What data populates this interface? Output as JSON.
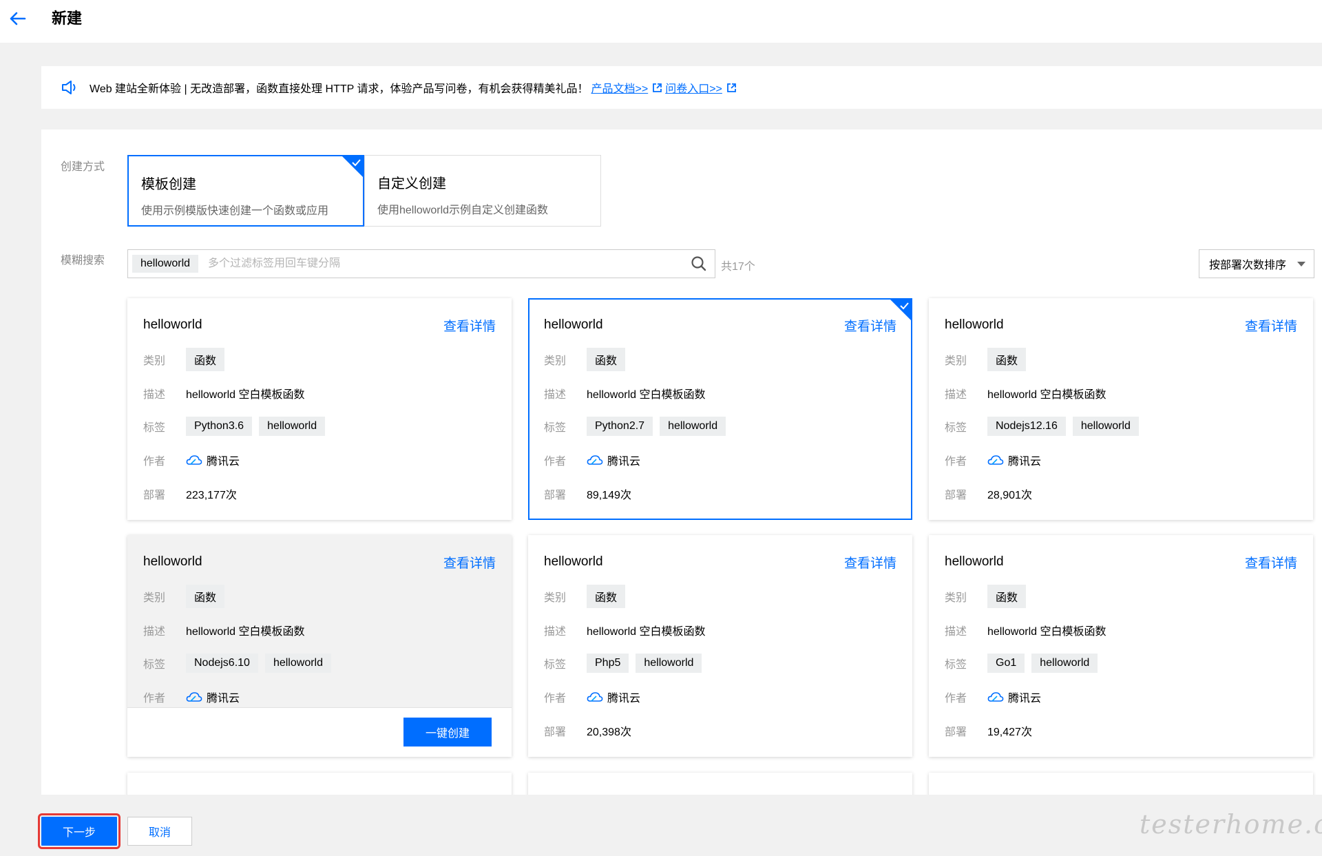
{
  "header": {
    "title": "新建"
  },
  "notice": {
    "text": "Web 建站全新体验 | 无改造部署，函数直接处理 HTTP 请求，体验产品写问卷，有机会获得精美礼品！",
    "link1": "产品文档>>",
    "link2": "问卷入口>>"
  },
  "create_mode": {
    "label": "创建方式",
    "options": [
      {
        "title": "模板创建",
        "desc": "使用示例模版快速创建一个函数或应用"
      },
      {
        "title": "自定义创建",
        "desc": "使用helloworld示例自定义创建函数"
      }
    ]
  },
  "search": {
    "label": "模糊搜索",
    "tag": "helloworld",
    "placeholder": "多个过滤标签用回车键分隔",
    "count": "共17个",
    "sort": "按部署次数排序"
  },
  "card_labels": {
    "detail": "查看详情",
    "category": "类别",
    "desc": "描述",
    "tags": "标签",
    "author": "作者",
    "deploy": "部署",
    "one_click": "一键创建"
  },
  "cards": [
    {
      "name": "helloworld",
      "category": "函数",
      "desc": "helloworld 空白模板函数",
      "tags": [
        "Python3.6",
        "helloworld"
      ],
      "author": "腾讯云",
      "deploy": "223,177次"
    },
    {
      "name": "helloworld",
      "category": "函数",
      "desc": "helloworld 空白模板函数",
      "tags": [
        "Python2.7",
        "helloworld"
      ],
      "author": "腾讯云",
      "deploy": "89,149次"
    },
    {
      "name": "helloworld",
      "category": "函数",
      "desc": "helloworld 空白模板函数",
      "tags": [
        "Nodejs12.16",
        "helloworld"
      ],
      "author": "腾讯云",
      "deploy": "28,901次"
    },
    {
      "name": "helloworld",
      "category": "函数",
      "desc": "helloworld 空白模板函数",
      "tags": [
        "Nodejs6.10",
        "helloworld"
      ],
      "author": "腾讯云"
    },
    {
      "name": "helloworld",
      "category": "函数",
      "desc": "helloworld 空白模板函数",
      "tags": [
        "Php5",
        "helloworld"
      ],
      "author": "腾讯云",
      "deploy": "20,398次"
    },
    {
      "name": "helloworld",
      "category": "函数",
      "desc": "helloworld 空白模板函数",
      "tags": [
        "Go1",
        "helloworld"
      ],
      "author": "腾讯云",
      "deploy": "19,427次"
    }
  ],
  "footer": {
    "next": "下一步",
    "cancel": "取消"
  },
  "watermark": "testerhome.com",
  "colors": {
    "accent": "#006eff",
    "highlight_border": "#e53935"
  }
}
